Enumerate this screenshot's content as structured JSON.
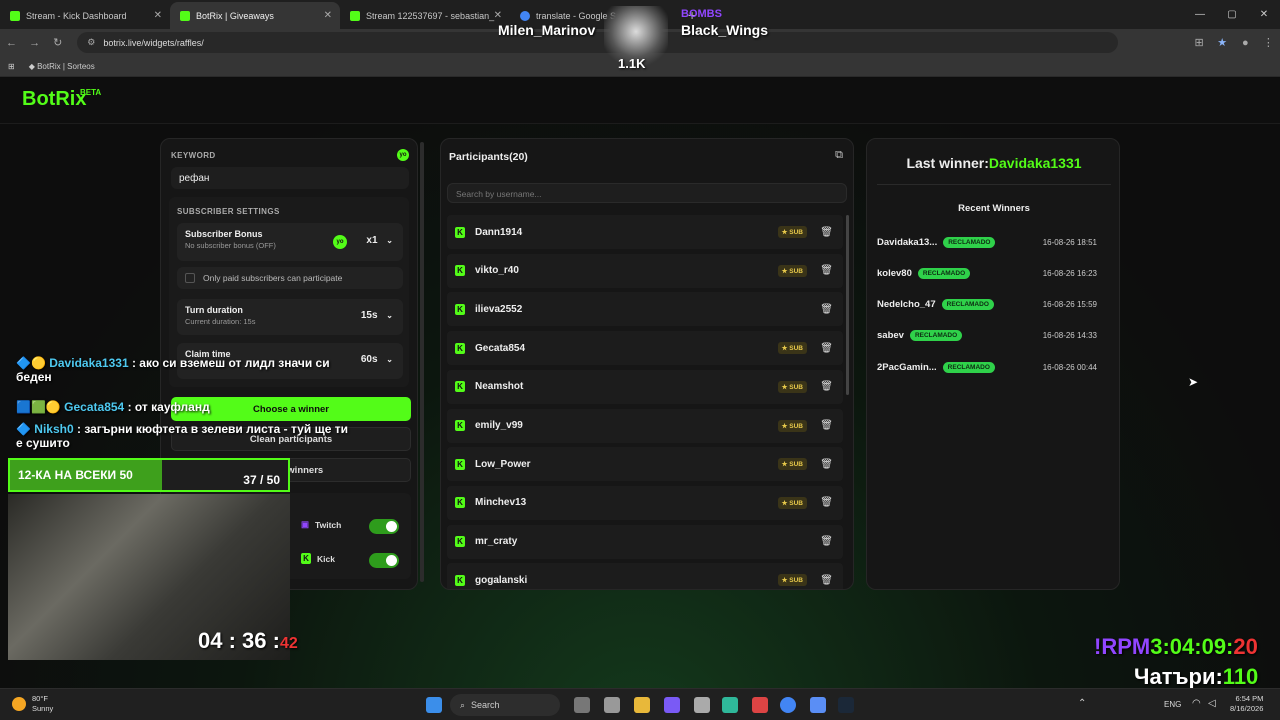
{
  "browser": {
    "tabs": [
      {
        "title": "Stream - Kick Dashboard",
        "color": "#53fc18"
      },
      {
        "title": "BotRix | Giveaways",
        "color": "#53fc18"
      },
      {
        "title": "Stream 122537697 - sebastian_",
        "color": "#53fc18"
      },
      {
        "title": "translate - Google Search",
        "color": "#4285f4"
      }
    ],
    "url": "botrix.live/widgets/raffles/",
    "bookmark": "BotRix | Sorteos"
  },
  "app": {
    "logo": "BotRix",
    "logo_badge": "BETA"
  },
  "settings": {
    "keyword_label": "KEYWORD",
    "keyword_value": "рефан",
    "sub_settings_label": "SUBSCRIBER SETTINGS",
    "sub_bonus_title": "Subscriber Bonus",
    "sub_bonus_sub": "No subscriber bonus (OFF)",
    "sub_bonus_value": "x1",
    "only_paid_label": "Only paid subscribers can participate",
    "turn_title": "Turn duration",
    "turn_sub": "Current duration: 15s",
    "turn_value": "15s",
    "claim_title": "Claim time",
    "claim_value": "60s",
    "choose_btn": "Choose a winner",
    "clean_participants_btn": "Clean participants",
    "clean_winners_btn": "Clean winners",
    "platform_twitch": "Twitch",
    "platform_kick": "Kick"
  },
  "participants": {
    "title": "Participants(20)",
    "search_placeholder": "Search by username...",
    "sub_label": "SUB",
    "rows": [
      {
        "name": "Dann1914",
        "sub": true
      },
      {
        "name": "vikto_r40",
        "sub": true
      },
      {
        "name": "ilieva2552",
        "sub": false
      },
      {
        "name": "Gecata854",
        "sub": true
      },
      {
        "name": "Neamshot",
        "sub": true
      },
      {
        "name": "emily_v99",
        "sub": true
      },
      {
        "name": "Low_Power",
        "sub": true
      },
      {
        "name": "Minchev13",
        "sub": true
      },
      {
        "name": "mr_craty",
        "sub": false
      },
      {
        "name": "gogalanski",
        "sub": true
      }
    ]
  },
  "winners": {
    "last_label": "Last winner:",
    "last_name": "Davidaka1331",
    "recent_title": "Recent Winners",
    "badge": "RECLAMADO",
    "rows": [
      {
        "name": "Davidaka13...",
        "date": "16-08-26 18:51"
      },
      {
        "name": "kolev80",
        "date": "16-08-26 16:23"
      },
      {
        "name": "Nedelcho_47",
        "date": "16-08-26 15:59"
      },
      {
        "name": "sabev",
        "date": "16-08-26 14:33"
      },
      {
        "name": "2PacGamin...",
        "date": "16-08-26 00:44"
      }
    ]
  },
  "stream_overlay": {
    "top_left_name": "Milen_Marinov",
    "top_right_name": "Black_Wings",
    "top_right_tag": "BOMBS",
    "top_count": "1.1K",
    "chat": [
      {
        "user": "Davidaka1331",
        "text": ": ако си вземеш от лидл значи си беден"
      },
      {
        "user": "Gecata854",
        "text": ": от кауфланд"
      },
      {
        "user": "Niksh0",
        "text": ": загърни кюфтета в зелеви листа - туй ще ти е сушито"
      }
    ],
    "goal_label": "12-КА НА ВСЕКИ 50",
    "goal_progress": "37 / 50",
    "goal_fraction": 0.74,
    "timer": "04 : 36 :",
    "timer_sec": "42",
    "rpm_label": "!RPM",
    "rpm_value": "3:04:09:",
    "rpm_value_end": "20",
    "count_label": "Чатъри:",
    "count_value": "110"
  },
  "taskbar": {
    "weather_temp": "80°F",
    "weather_desc": "Sunny",
    "search": "Search",
    "lang": "ENG",
    "time": "6:54 PM",
    "date": "8/16/2026"
  }
}
